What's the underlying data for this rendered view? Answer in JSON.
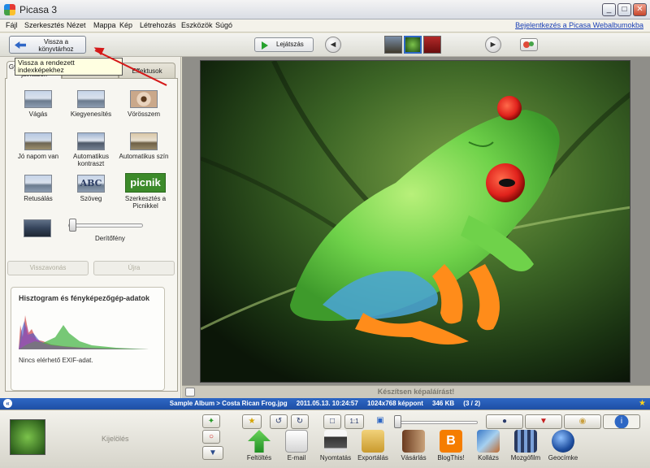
{
  "window": {
    "title": "Picasa 3",
    "minimize": "_",
    "maximize": "□",
    "close": "✕"
  },
  "menu": {
    "items": [
      "Fájl",
      "Szerkesztés",
      "Nézet",
      "Mappa",
      "Kép",
      "Létrehozás",
      "Eszközök",
      "Súgó"
    ],
    "login_link": "Bejelentkezés a Picasa Webalbumokba"
  },
  "toolbar": {
    "back_label": "Vissza a könyvtárhoz",
    "slideshow_label": "Lejátszás",
    "prev_glyph": "◄",
    "next_glyph": "►"
  },
  "tooltip": {
    "text": "Vissza a rendezett indexképekhez"
  },
  "tabs": {
    "basic": "Gyakran használt javítások",
    "tuning": "Finomhangolás",
    "effects": "Effektusok"
  },
  "tools": {
    "crop": "Vágás",
    "straighten": "Kiegyenesítés",
    "redeye": "Vörösszem",
    "feeling_lucky": "Jó napom van",
    "auto_contrast": "Automatikus kontraszt",
    "auto_color": "Automatikus szín",
    "retouch": "Retusálás",
    "text": "Szöveg",
    "text_icon": "ABC",
    "picnik": "Szerkesztés a Picnikkel",
    "picnik_logo": "picnik",
    "fill_light_label": "Derítőfény",
    "fill_light_value": 0
  },
  "history_buttons": {
    "undo": "Visszavonás",
    "redo": "Újra"
  },
  "histogram": {
    "title": "Hisztogram és fényképezőgép-adatok",
    "exif_status": "Nincs elérhető EXIF-adat."
  },
  "caption": {
    "placeholder": "Készítsen képaláírást!"
  },
  "infobar": {
    "path": "Sample Album > Costa Rican Frog.jpg",
    "datetime": "2011.05.13. 10:24:57",
    "dimensions": "1024x768 képpont",
    "size": "346 KB",
    "position": "(3 / 2)",
    "left_glyph": "«",
    "star": "★"
  },
  "tray": {
    "selection_label": "Kijelölés",
    "actions": [
      "Feltöltés",
      "E-mail",
      "Nyomtatás",
      "Exportálás",
      "Vásárlás",
      "BlogThis!",
      "Kollázs",
      "Mozgófilm",
      "Geocímke"
    ]
  },
  "colors": {
    "accent_blue": "#2e67c4",
    "annotation_red": "#d51919",
    "frog_green": "#6fd24a",
    "eye_red": "#e0221c"
  }
}
